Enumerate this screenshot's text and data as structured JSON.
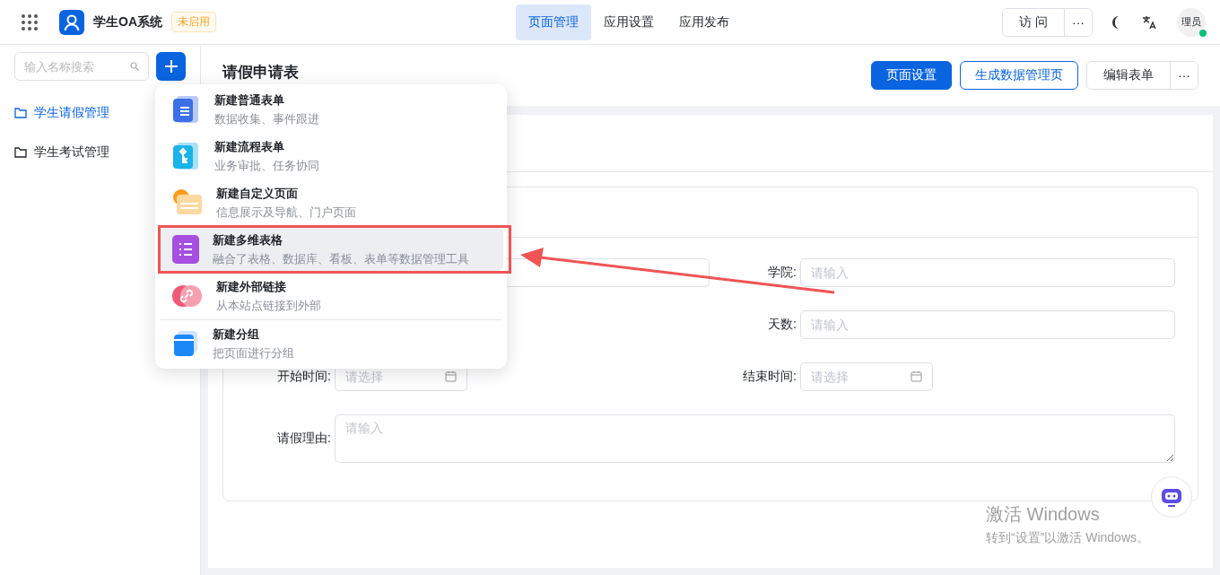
{
  "app": {
    "title": "学生OA系统",
    "badge": "未启用"
  },
  "nav": [
    {
      "label": "页面管理",
      "selected": true
    },
    {
      "label": "应用设置",
      "selected": false
    },
    {
      "label": "应用发布",
      "selected": false
    }
  ],
  "top_right": {
    "visit": "访 问",
    "more": "···",
    "avatar": "理员",
    "online": true
  },
  "sidebar": {
    "search": {
      "placeholder": "输入名称搜索"
    },
    "items": [
      {
        "label": "学生请假管理",
        "selected": true
      },
      {
        "label": "学生考试管理",
        "selected": false
      }
    ]
  },
  "page": {
    "title": "请假申请表",
    "buttons": [
      {
        "label": "页面设置",
        "kind": "primary"
      },
      {
        "label": "生成数据管理页",
        "kind": "outline"
      },
      {
        "label": "编辑表单",
        "kind": "default"
      }
    ],
    "more": "···"
  },
  "form": {
    "rows": [
      {
        "left": {
          "kind": "input"
        },
        "right": {
          "kind": "input",
          "label": "学院:",
          "placeholder": "请输入"
        }
      },
      {
        "left": {
          "kind": "none"
        },
        "right": {
          "kind": "input",
          "label": "天数:",
          "placeholder": "请输入"
        }
      },
      {
        "left": {
          "kind": "date",
          "label": "开始时间:",
          "placeholder": "请选择"
        },
        "right": {
          "kind": "date",
          "label": "结束时间:",
          "placeholder": "请选择"
        }
      },
      {
        "left": {
          "kind": "textarea",
          "label": "请假理由:",
          "placeholder": "请输入"
        }
      }
    ]
  },
  "menu": {
    "sections": [
      [
        {
          "title": "新建普通表单",
          "desc": "数据收集、事件跟进",
          "selected": false
        },
        {
          "title": "新建流程表单",
          "desc": "业务审批、任务协同",
          "selected": false
        },
        {
          "title": "新建自定义页面",
          "desc": "信息展示及导航、门户页面",
          "selected": false
        },
        {
          "title": "新建多维表格",
          "desc": "融合了表格、数据库、看板、表单等数据管理工具",
          "selected": true
        },
        {
          "title": "新建外部链接",
          "desc": "从本站点链接到外部",
          "selected": false
        }
      ],
      [
        {
          "title": "新建分组",
          "desc": "把页面进行分组",
          "selected": false
        }
      ]
    ]
  },
  "activation": {
    "title": "激活 Windows",
    "text": "转到“设置”以激活 Windows。"
  }
}
